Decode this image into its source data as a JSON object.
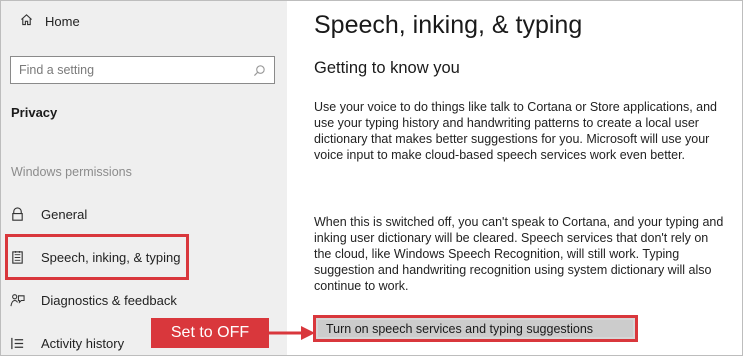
{
  "sidebar": {
    "home": {
      "label": "Home",
      "icon": "home-icon"
    },
    "search": {
      "placeholder": "Find a setting",
      "icon": "search-icon"
    },
    "section_title": "Privacy",
    "group_label": "Windows permissions",
    "items": [
      {
        "label": "General",
        "icon": "lock-icon"
      },
      {
        "label": "Speech, inking, & typing",
        "icon": "notepad-icon",
        "highlighted": true
      },
      {
        "label": "Diagnostics & feedback",
        "icon": "feedback-icon"
      },
      {
        "label": "Activity history",
        "icon": "activity-icon"
      }
    ]
  },
  "main": {
    "title": "Speech, inking, & typing",
    "subtitle": "Getting to know you",
    "paragraph1": "Use your voice to do things like talk to Cortana or Store applications, and use your typing history and handwriting patterns to create a local user dictionary that makes better suggestions for you. Microsoft will use your voice input to make cloud-based speech services work even better.",
    "paragraph2": "When this is switched off, you can't speak to Cortana, and your typing and inking user dictionary will be cleared. Speech services that don't rely on the cloud, like Windows Speech Recognition, will still work. Typing suggestion and handwriting recognition using system dictionary will also continue to work.",
    "button_label": "Turn on speech services and typing suggestions"
  },
  "annotation": {
    "callout_label": "Set to OFF",
    "color": "#d9373c"
  }
}
